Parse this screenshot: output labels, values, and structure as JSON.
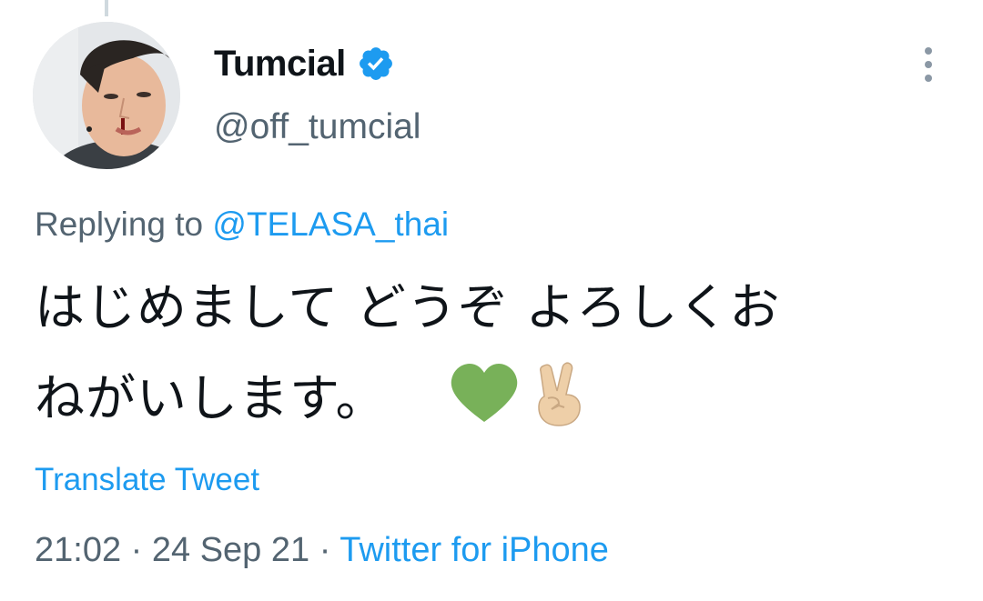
{
  "author": {
    "display_name": "Tumcial",
    "handle": "@off_tumcial",
    "verified_icon": "verified-badge-icon",
    "avatar_icon": "profile-photo"
  },
  "reply": {
    "prefix": "Replying to",
    "mention": "@TELASA_thai"
  },
  "tweet": {
    "line1": "はじめまして どうぞ よろしくお",
    "line2": "ねがいします。",
    "emojis": [
      "green-heart-icon",
      "victory-hand-icon"
    ]
  },
  "translate_label": "Translate Tweet",
  "meta": {
    "time": "21:02",
    "date": "24 Sep 21",
    "separator": "·",
    "source": "Twitter for iPhone"
  },
  "colors": {
    "accent": "#1d9bf0",
    "secondary_text": "#536471",
    "primary_text": "#0f1419"
  }
}
